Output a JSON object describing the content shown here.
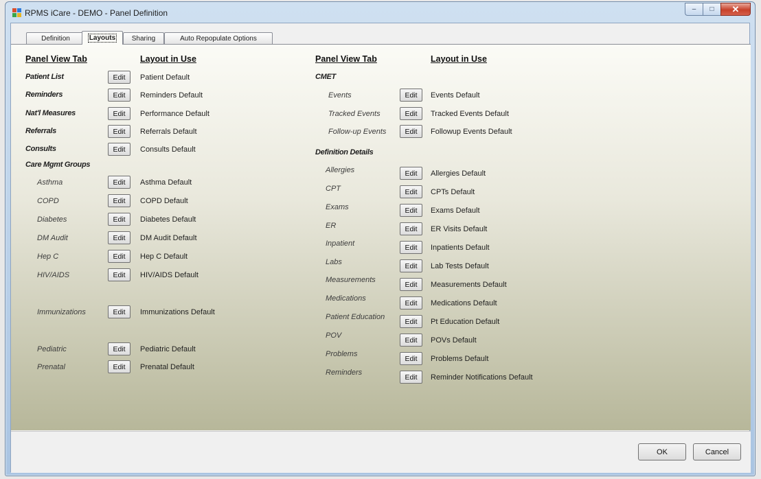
{
  "window": {
    "title": "RPMS iCare - DEMO - Panel Definition",
    "minimize_glyph": "–",
    "maximize_glyph": "□",
    "close_glyph": "✕"
  },
  "tabs": [
    {
      "label": "Definition"
    },
    {
      "label": "Layouts"
    },
    {
      "label": "Sharing"
    },
    {
      "label": "Auto Repopulate Options"
    }
  ],
  "headers": {
    "left_tab": "Panel View Tab",
    "left_layout": "Layout in Use",
    "right_tab": "Panel View Tab",
    "right_layout": "Layout in Use"
  },
  "edit_label": "Edit",
  "left_rows": [
    {
      "label": "Patient List",
      "value": "Patient Default"
    },
    {
      "label": "Reminders",
      "value": "Reminders Default"
    },
    {
      "label": "Nat'l Measures",
      "value": "Performance Default"
    },
    {
      "label": "Referrals",
      "value": "Referrals Default"
    },
    {
      "label": "Consults",
      "value": "Consults Default"
    }
  ],
  "care_mgmt_title": "Care Mgmt Groups",
  "care_mgmt_rows": [
    {
      "label": "Asthma",
      "value": "Asthma Default"
    },
    {
      "label": "COPD",
      "value": "COPD Default"
    },
    {
      "label": "Diabetes",
      "value": "Diabetes Default"
    },
    {
      "label": "DM Audit",
      "value": "DM Audit Default"
    },
    {
      "label": "Hep C",
      "value": "Hep C Default"
    },
    {
      "label": "HIV/AIDS",
      "value": "HIV/AIDS Default"
    },
    {
      "label": "Immunizations",
      "value": "Immunizations Default"
    },
    {
      "label": "Pediatric",
      "value": "Pediatric Default"
    },
    {
      "label": "Prenatal",
      "value": "Prenatal Default"
    }
  ],
  "cmet_title": "CMET",
  "cmet_rows": [
    {
      "label": "Events",
      "value": "Events Default"
    },
    {
      "label": "Tracked Events",
      "value": "Tracked Events Default"
    },
    {
      "label": "Follow-up Events",
      "value": "Followup Events Default"
    }
  ],
  "defdetails_title": "Definition Details",
  "defdetails_rows": [
    {
      "label": "Allergies",
      "value": "Allergies Default"
    },
    {
      "label": "CPT",
      "value": "CPTs Default"
    },
    {
      "label": "Exams",
      "value": "Exams Default"
    },
    {
      "label": "ER",
      "value": "ER Visits Default"
    },
    {
      "label": "Inpatient",
      "value": "Inpatients Default"
    },
    {
      "label": "Labs",
      "value": "Lab Tests Default"
    },
    {
      "label": "Measurements",
      "value": "Measurements Default"
    },
    {
      "label": "Medications",
      "value": "Medications Default"
    },
    {
      "label": "Patient Education",
      "value": "Pt Education Default"
    },
    {
      "label": "POV",
      "value": "POVs Default"
    },
    {
      "label": "Problems",
      "value": "Problems Default"
    },
    {
      "label": "Reminders",
      "value": "Reminder Notifications Default"
    }
  ],
  "footer": {
    "ok_label": "OK",
    "cancel_label": "Cancel"
  }
}
